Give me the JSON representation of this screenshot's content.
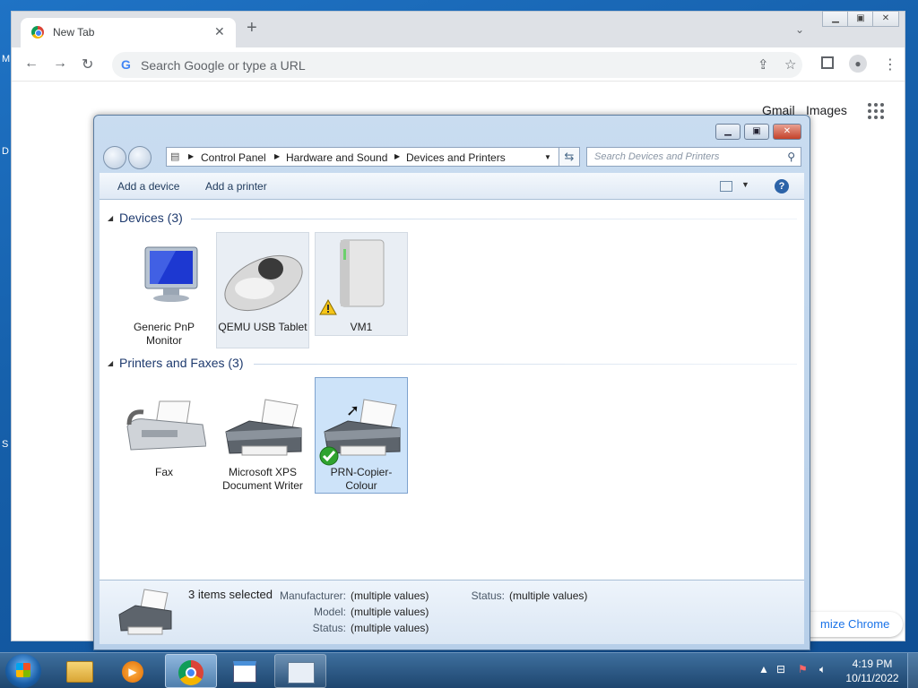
{
  "chrome": {
    "tab_title": "New Tab",
    "omnibox_placeholder": "Search Google or type a URL",
    "links": {
      "gmail": "Gmail",
      "images": "Images"
    },
    "customize_label": "mize Chrome"
  },
  "explorer": {
    "breadcrumb": [
      "Control Panel",
      "Hardware and Sound",
      "Devices and Printers"
    ],
    "search_placeholder": "Search Devices and Printers",
    "commands": {
      "add_device": "Add a device",
      "add_printer": "Add a printer"
    },
    "groups": [
      {
        "title": "Devices (3)",
        "items": [
          {
            "label": "Generic PnP Monitor",
            "icon": "monitor-icon"
          },
          {
            "label": "QEMU USB Tablet",
            "icon": "mouse-icon"
          },
          {
            "label": "VM1",
            "icon": "computer-tower-icon",
            "badge": "warning-icon"
          }
        ]
      },
      {
        "title": "Printers and Faxes (3)",
        "items": [
          {
            "label": "Fax",
            "icon": "fax-icon"
          },
          {
            "label": "Microsoft XPS Document Writer",
            "icon": "printer-icon"
          },
          {
            "label": "PRN-Copier-Colour",
            "icon": "printer-icon",
            "badge": "default-check-icon",
            "selected": true
          }
        ]
      }
    ],
    "details": {
      "summary": "3 items selected",
      "rows": [
        {
          "label": "Manufacturer:",
          "value": "(multiple values)"
        },
        {
          "label": "Model:",
          "value": "(multiple values)"
        },
        {
          "label": "Status:",
          "value": "(multiple values)"
        }
      ],
      "status2": {
        "label": "Status:",
        "value": "(multiple values)"
      }
    }
  },
  "taskbar": {
    "items": [
      "windows-explorer-icon",
      "media-player-icon",
      "chrome-icon",
      "notepad-icon",
      "devices-printers-icon"
    ],
    "clock_time": "4:19 PM",
    "clock_date": "10/11/2022"
  },
  "colors": {
    "accent": "#1a73e8",
    "selection": "#cde3f9"
  }
}
